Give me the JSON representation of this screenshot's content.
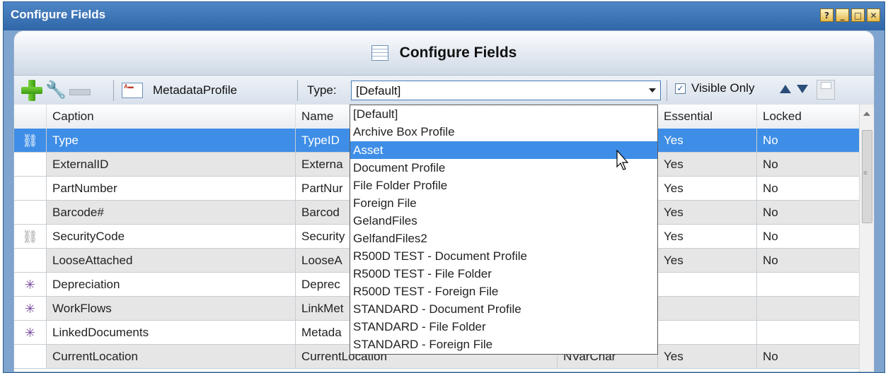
{
  "window": {
    "title": "Configure Fields",
    "controls": [
      "?",
      "_",
      "□",
      "✕"
    ]
  },
  "header": {
    "title": "Configure Fields"
  },
  "toolbar": {
    "metadata_label": "MetadataProfile",
    "type_label": "Type:",
    "type_value": "[Default]",
    "visible_only_label": "Visible Only",
    "visible_only_checked": "✓"
  },
  "grid": {
    "columns": [
      "Caption",
      "Name",
      "Essential",
      "Locked"
    ],
    "rows": [
      {
        "icon": "link",
        "caption": "Type",
        "name": "TypeID",
        "essential": "Yes",
        "locked": "No"
      },
      {
        "icon": "",
        "caption": "ExternalID",
        "name": "Externa",
        "essential": "Yes",
        "locked": "No"
      },
      {
        "icon": "",
        "caption": "PartNumber",
        "name": "PartNur",
        "essential": "Yes",
        "locked": "No"
      },
      {
        "icon": "",
        "caption": "Barcode#",
        "name": "Barcod",
        "essential": "Yes",
        "locked": "No"
      },
      {
        "icon": "link",
        "caption": "SecurityCode",
        "name": "Security",
        "essential": "Yes",
        "locked": "No"
      },
      {
        "icon": "",
        "caption": "LooseAttached",
        "name": "LooseA",
        "essential": "Yes",
        "locked": "No"
      },
      {
        "icon": "star",
        "caption": "Depreciation",
        "name": "Deprec",
        "essential": "",
        "locked": ""
      },
      {
        "icon": "star",
        "caption": "WorkFlows",
        "name": "LinkMet",
        "essential": "",
        "locked": ""
      },
      {
        "icon": "star",
        "caption": "LinkedDocuments",
        "name": "Metada",
        "essential": "",
        "locked": ""
      },
      {
        "icon": "",
        "caption": "CurrentLocation",
        "name": "CurrentLocation",
        "type": "NVarChar",
        "essential": "Yes",
        "locked": "No"
      }
    ]
  },
  "dropdown": {
    "options": [
      "[Default]",
      "Archive Box Profile",
      "Asset",
      "Document Profile",
      "File Folder Profile",
      "Foreign File",
      "GelandFiles",
      "GelfandFiles2",
      "R500D TEST - Document Profile",
      "R500D TEST - File Folder",
      "R500D TEST - Foreign File",
      "STANDARD - Document Profile",
      "STANDARD - File Folder",
      "STANDARD - Foreign File"
    ],
    "highlighted": "Asset"
  },
  "icons": {
    "link": "⛓",
    "star": "✳"
  },
  "colors": {
    "selection": "#3e8ee7",
    "titlebar": "#2f66a8"
  }
}
